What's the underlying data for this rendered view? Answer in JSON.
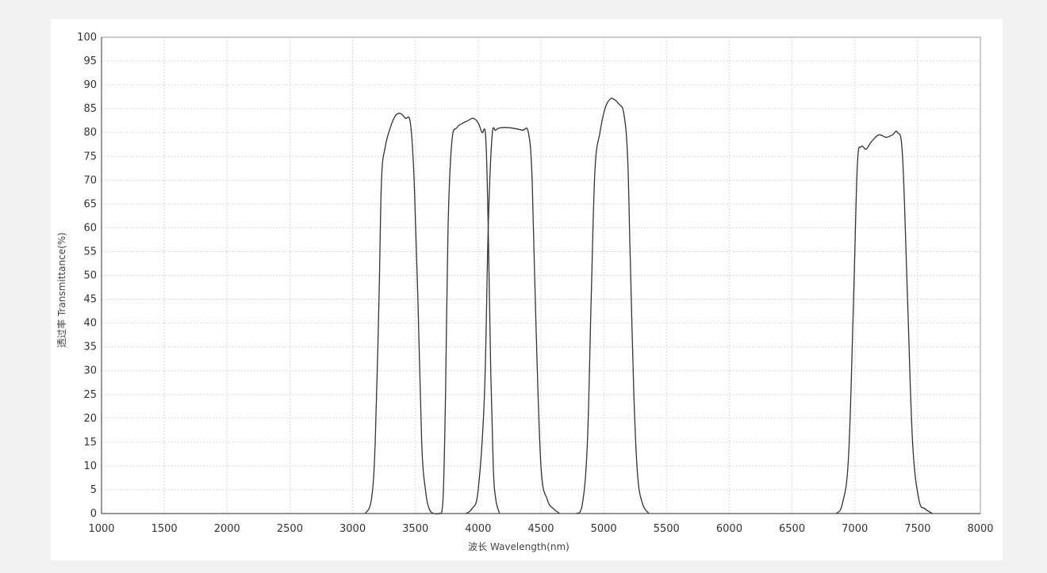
{
  "chart_data": {
    "type": "line",
    "title": "",
    "xlabel": "波长 Wavelength(nm)",
    "ylabel": "透过率 Transmittance(%)",
    "xlim": [
      1000,
      8000
    ],
    "ylim": [
      0,
      100
    ],
    "xticks": [
      1000,
      1500,
      2000,
      2500,
      3000,
      3500,
      4000,
      4500,
      5000,
      5500,
      6000,
      6500,
      7000,
      7500,
      8000
    ],
    "yticks": [
      0,
      5,
      10,
      15,
      20,
      25,
      30,
      35,
      40,
      45,
      50,
      55,
      60,
      65,
      70,
      75,
      80,
      85,
      90,
      95,
      100
    ],
    "grid": true,
    "legend": "none",
    "line_color": "#333333",
    "series": [
      {
        "x": [
          3100,
          3150,
          3180,
          3210,
          3230,
          3260,
          3300,
          3340,
          3380,
          3420,
          3460,
          3490,
          3520,
          3550,
          3580,
          3610,
          3650,
          3700
        ],
        "y": [
          0,
          3,
          15,
          45,
          70,
          77,
          81,
          83.5,
          84,
          83,
          82,
          70,
          45,
          15,
          5,
          1,
          0,
          0
        ]
      },
      {
        "x": [
          3690,
          3720,
          3740,
          3760,
          3790,
          3830,
          3880,
          3920,
          3960,
          4000,
          4030,
          4060,
          4080,
          4100,
          4120,
          4140,
          4170
        ],
        "y": [
          0,
          3,
          25,
          60,
          78,
          81,
          82,
          82.5,
          83,
          82,
          80,
          79,
          60,
          30,
          10,
          3,
          0
        ]
      },
      {
        "x": [
          3900,
          3950,
          4000,
          4050,
          4080,
          4110,
          4140,
          4180,
          4250,
          4350,
          4400,
          4430,
          4460,
          4500,
          4550,
          4600,
          4650
        ],
        "y": [
          0,
          1,
          5,
          25,
          60,
          79,
          80.5,
          81,
          81,
          80.5,
          80,
          70,
          40,
          10,
          3,
          1,
          0
        ]
      },
      {
        "x": [
          4780,
          4830,
          4870,
          4900,
          4930,
          4970,
          5010,
          5050,
          5080,
          5120,
          5160,
          5190,
          5210,
          5240,
          5270,
          5310,
          5360
        ],
        "y": [
          0,
          2,
          15,
          45,
          72,
          80,
          85,
          87,
          87,
          86,
          84,
          75,
          55,
          25,
          8,
          2,
          0
        ]
      },
      {
        "x": [
          6850,
          6900,
          6950,
          6990,
          7020,
          7050,
          7090,
          7130,
          7190,
          7250,
          7300,
          7340,
          7380,
          7420,
          7460,
          7510,
          7560,
          7620
        ],
        "y": [
          0,
          2,
          12,
          45,
          73,
          77,
          76.5,
          78,
          79.5,
          79,
          79.5,
          80,
          75,
          45,
          15,
          3,
          1,
          0
        ]
      }
    ]
  }
}
